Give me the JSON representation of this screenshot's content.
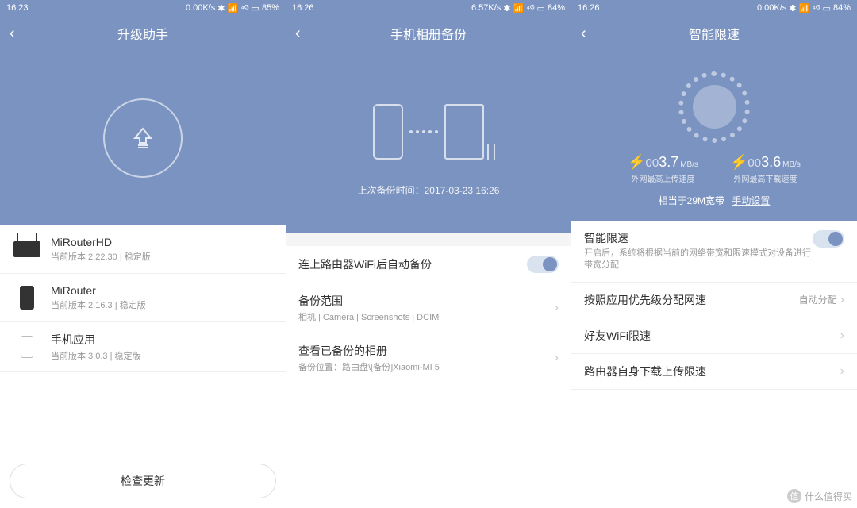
{
  "panel1": {
    "status": {
      "time": "16:23",
      "speed": "0.00K/s",
      "battery": "85%"
    },
    "title": "升级助手",
    "items": [
      {
        "title": "MiRouterHD",
        "sub": "当前版本 2.22.30 | 稳定版"
      },
      {
        "title": "MiRouter",
        "sub": "当前版本 2.16.3 | 稳定版"
      },
      {
        "title": "手机应用",
        "sub": "当前版本 3.0.3 | 稳定版"
      }
    ],
    "check_button": "检查更新"
  },
  "panel2": {
    "status": {
      "time": "16:26",
      "speed": "6.57K/s",
      "battery": "84%"
    },
    "title": "手机相册备份",
    "backup_time": "上次备份时间：2017-03-23 16:26",
    "items": [
      {
        "title": "连上路由器WiFi后自动备份"
      },
      {
        "title": "备份范围",
        "sub": "相机 | Camera | Screenshots | DCIM"
      },
      {
        "title": "查看已备份的相册",
        "sub": "备份位置：路由盘\\[备份]Xiaomi-MI 5"
      }
    ]
  },
  "panel3": {
    "status": {
      "time": "16:26",
      "speed": "0.00K/s",
      "battery": "84%"
    },
    "title": "智能限速",
    "upload": {
      "pre": "00",
      "val": "3.7",
      "unit": "MB/s",
      "label": "外网最高上传速度"
    },
    "download": {
      "pre": "00",
      "val": "3.6",
      "unit": "MB/s",
      "label": "外网最高下载速度"
    },
    "bandwidth": "相当于29M宽带",
    "manual": "手动设置",
    "smart": {
      "title": "智能限速",
      "sub": "开启后，系统将根据当前的网络带宽和限速模式对设备进行带宽分配"
    },
    "items": [
      {
        "title": "按照应用优先级分配网速",
        "right": "自动分配"
      },
      {
        "title": "好友WiFi限速"
      },
      {
        "title": "路由器自身下载上传限速"
      }
    ]
  },
  "signal_icons": "✱ ⇋ ⁴ᴳ",
  "watermark": "什么值得买"
}
